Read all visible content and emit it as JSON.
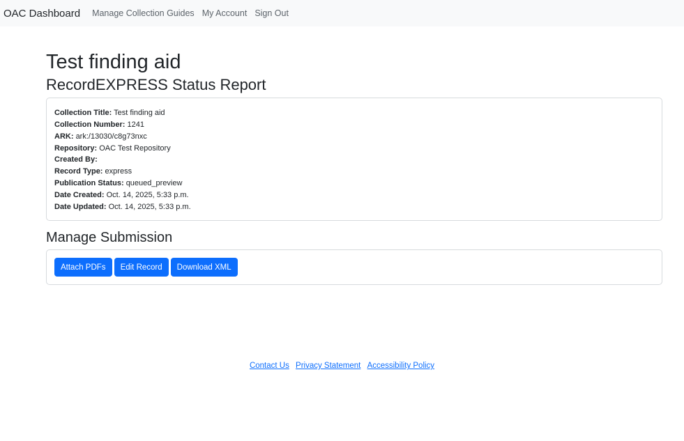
{
  "navbar": {
    "brand": "OAC Dashboard",
    "links": [
      "Manage Collection Guides",
      "My Account",
      "Sign Out"
    ]
  },
  "page": {
    "title": "Test finding aid",
    "subtitle": "RecordEXPRESS Status Report"
  },
  "details": [
    {
      "label": "Collection Title:",
      "value": "Test finding aid"
    },
    {
      "label": "Collection Number:",
      "value": "1241"
    },
    {
      "label": "ARK:",
      "value": "ark:/13030/c8g73nxc"
    },
    {
      "label": "Repository:",
      "value": "OAC Test Repository"
    },
    {
      "label": "Created By:",
      "value": ""
    },
    {
      "label": "Record Type:",
      "value": "express"
    },
    {
      "label": "Publication Status:",
      "value": "queued_preview"
    },
    {
      "label": "Date Created:",
      "value": "Oct. 14, 2025, 5:33 p.m."
    },
    {
      "label": "Date Updated:",
      "value": "Oct. 14, 2025, 5:33 p.m."
    }
  ],
  "manage": {
    "heading": "Manage Submission",
    "buttons": [
      "Attach PDFs",
      "Edit Record",
      "Download XML"
    ]
  },
  "footer": {
    "links": [
      "Contact Us",
      "Privacy Statement",
      "Accessibility Policy"
    ]
  },
  "colors": {
    "primary": "#0d6efd",
    "navbar_bg": "#f8f9fa"
  }
}
